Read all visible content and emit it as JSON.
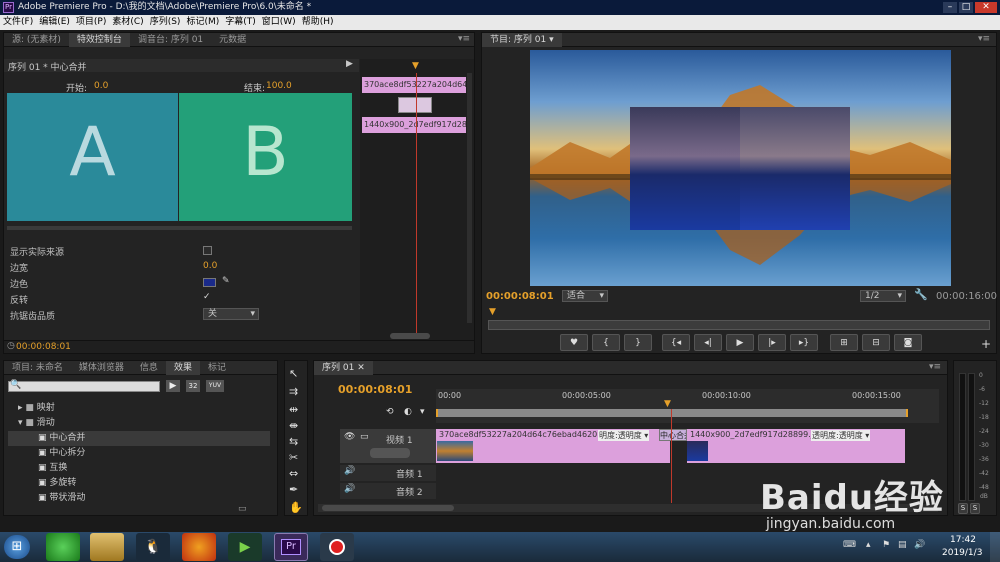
{
  "app": {
    "title": "Adobe Premiere Pro - D:\\我的文档\\Adobe\\Premiere Pro\\6.0\\未命名 *",
    "logo_text": "Pr"
  },
  "menu": [
    "文件(F)",
    "编辑(E)",
    "项目(P)",
    "素材(C)",
    "序列(S)",
    "标记(M)",
    "字幕(T)",
    "窗口(W)",
    "帮助(H)"
  ],
  "left_tabs": [
    "源: (无素材)",
    "特效控制台",
    "调音台: 序列 01",
    "元数据"
  ],
  "effect_controls": {
    "header": "序列 01 * 中心合并",
    "start_label": "开始:",
    "start_value": "0.0",
    "end_label": "结束:",
    "end_value": "100.0",
    "preview_a": "A",
    "preview_b": "B",
    "clip_a": "370ace8df53227a204d64c7",
    "clip_b": "1440x900_2d7edf917d28899",
    "props": [
      {
        "label": "显示实际来源",
        "value": ""
      },
      {
        "label": "边宽",
        "value": "0.0"
      },
      {
        "label": "边色",
        "value": ""
      },
      {
        "label": "反转",
        "value": "✓"
      },
      {
        "label": "抗锯齿品质",
        "value": "关"
      }
    ],
    "timecode": "00:00:08:01",
    "border_color": "#1a2a8a"
  },
  "program": {
    "tab": "节目: 序列 01",
    "timecode": "00:00:08:01",
    "fit": "适合",
    "quality": "1/2",
    "duration": "00:00:16:00"
  },
  "project_tabs": [
    "项目: 未命名",
    "媒体浏览器",
    "信息",
    "效果",
    "标记"
  ],
  "effects_tree": [
    {
      "label": "映射",
      "type": "folder",
      "indent": 0
    },
    {
      "label": "滑动",
      "type": "folder",
      "indent": 0
    },
    {
      "label": "中心合并",
      "type": "item",
      "indent": 1
    },
    {
      "label": "中心拆分",
      "type": "item",
      "indent": 1
    },
    {
      "label": "互换",
      "type": "item",
      "indent": 1
    },
    {
      "label": "多旋转",
      "type": "item",
      "indent": 1
    },
    {
      "label": "带状滑动",
      "type": "item",
      "indent": 1
    }
  ],
  "effects_badges": [
    "32",
    "YUV"
  ],
  "timeline": {
    "tab": "序列 01",
    "timecode": "00:00:08:01",
    "ruler": [
      "00:00",
      "00:00:05:00",
      "00:00:10:00",
      "00:00:15:00"
    ],
    "tracks": [
      {
        "name": "视频 1",
        "kind": "video"
      },
      {
        "name": "音频 1",
        "kind": "audio"
      },
      {
        "name": "音频 2",
        "kind": "audio"
      }
    ],
    "clip1": "370ace8df53227a204d64c76ebad4620.jpg",
    "clip1_fx": "明度:透明度 ▾",
    "transition": "中心合并",
    "clip2": "1440x900_2d7edf917d28899.jpg",
    "clip2_fx": "透明度:透明度 ▾"
  },
  "meter": {
    "labels": [
      "0",
      "-6",
      "-12",
      "-18",
      "-24",
      "-30",
      "-36",
      "-42",
      "-48",
      "dB"
    ],
    "solo": [
      "S",
      "S"
    ]
  },
  "watermark": {
    "brand": "Baidu经验",
    "url": "jingyan.baidu.com"
  },
  "taskbar": {
    "time": "17:42",
    "date": "2019/1/3",
    "pr_label": "Pr"
  },
  "colors": {
    "accent": "#e5a02a",
    "clip": "#dca0dc",
    "playhead": "#c0392b"
  }
}
